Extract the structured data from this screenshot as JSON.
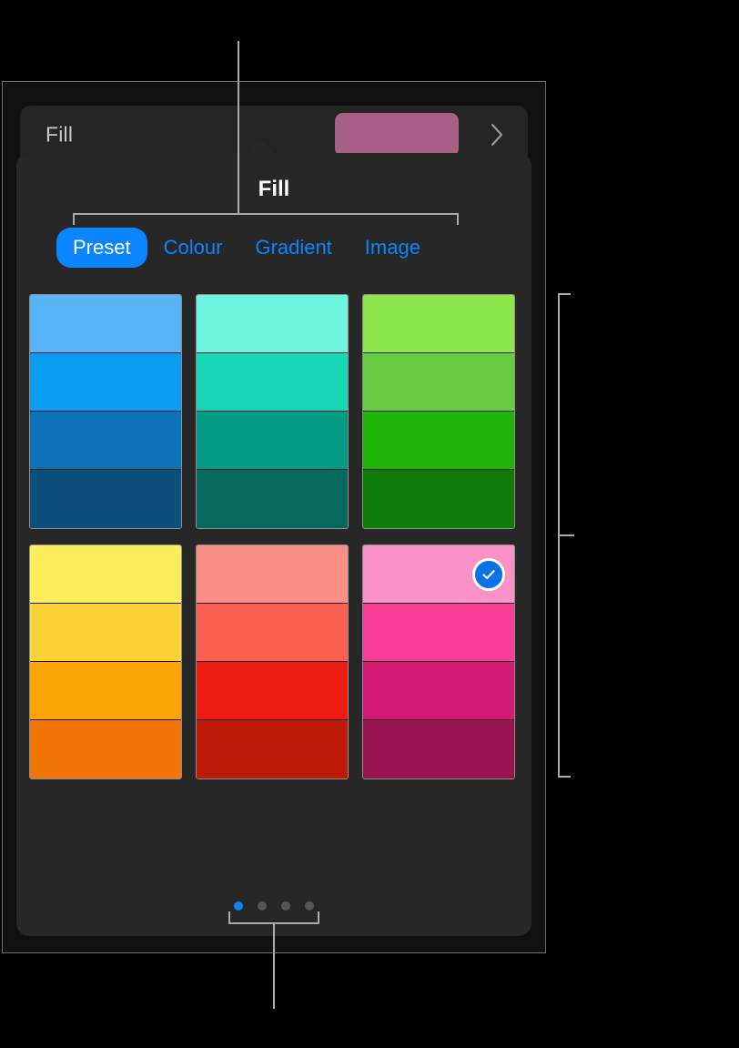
{
  "inspector": {
    "row_label": "Fill",
    "fill_chip_color": "#a85f85",
    "disclosure_icon": "chevron-right-icon"
  },
  "popover": {
    "title": "Fill",
    "tabs": [
      {
        "label": "Preset",
        "active": true
      },
      {
        "label": "Colour",
        "active": false
      },
      {
        "label": "Gradient",
        "active": false
      },
      {
        "label": "Image",
        "active": false
      }
    ],
    "accent_color": "#0a84ff",
    "background_color": "#272727",
    "selected_badge_icon": "checkmark-circle-icon",
    "page_dots": {
      "count": 4,
      "active_index": 0
    },
    "swatch_bands": [
      {
        "name": "cool-tones",
        "groups": [
          {
            "name": "blue-ramp",
            "selected": false,
            "colors": [
              "#59b4f7",
              "#0a9df2",
              "#0a72b5",
              "#0b4f7d"
            ]
          },
          {
            "name": "teal-ramp",
            "selected": false,
            "colors": [
              "#6ef5e0",
              "#17d7b6",
              "#069b85",
              "#07685f"
            ]
          },
          {
            "name": "green-ramp",
            "selected": false,
            "colors": [
              "#8ce84a",
              "#67cc42",
              "#1fb508",
              "#0f7b08"
            ]
          }
        ]
      },
      {
        "name": "warm-tones",
        "groups": [
          {
            "name": "yellow-orange-ramp",
            "selected": false,
            "colors": [
              "#fbed5c",
              "#fdd237",
              "#fca406",
              "#f17505"
            ]
          },
          {
            "name": "coral-red-ramp",
            "selected": false,
            "colors": [
              "#fa9085",
              "#fc6050",
              "#ed1c10",
              "#be1b06"
            ]
          },
          {
            "name": "pink-magenta-ramp",
            "selected": true,
            "selected_index": 0,
            "colors": [
              "#f993c7",
              "#fa3d96",
              "#d41a72",
              "#99134f"
            ]
          }
        ]
      }
    ]
  }
}
